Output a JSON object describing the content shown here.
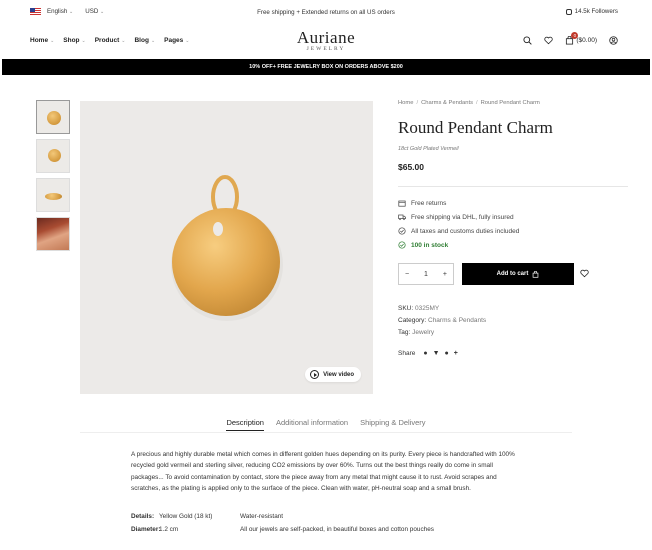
{
  "topbar": {
    "language": "English",
    "currency": "USD",
    "announcement": "Free shipping + Extended returns on all US orders",
    "followers": "14.5k Followers"
  },
  "nav": {
    "items": [
      "Home",
      "Shop",
      "Product",
      "Blog",
      "Pages"
    ]
  },
  "logo": {
    "name": "Auriane",
    "sub": "JEWELRY"
  },
  "cart": {
    "count": "0",
    "total": "($0.00)"
  },
  "promo": "10% OFF+ FREE JEWELRY BOX ON ORDERS ABOVE $200",
  "breadcrumb": [
    "Home",
    "Charms & Pendants",
    "Round Pendant Charm"
  ],
  "product": {
    "title": "Round Pendant Charm",
    "subtitle": "18ct Gold Plated Vermeil",
    "price": "$65.00",
    "features": [
      "Free returns",
      "Free shipping via DHL, fully insured",
      "All taxes and customs duties included",
      "100 in stock"
    ],
    "quantity": "1",
    "add_to_cart": "Add to cart",
    "view_video": "View video",
    "sku_label": "SKU:",
    "sku": "0325MY",
    "category_label": "Category:",
    "category": "Charms & Pendants",
    "tag_label": "Tag:",
    "tag": "Jewelry",
    "share_label": "Share"
  },
  "tabs": [
    "Description",
    "Additional information",
    "Shipping & Delivery"
  ],
  "description": "A precious and highly durable metal which comes in different golden hues depending on its purity. Every piece is handcrafted with 100% recycled gold vermeil and sterling silver, reducing CO2 emissions by over 60%. Turns out the best things really do come in small packages... To avoid contamination by contact, store the piece away from any metal that might cause it to rust. Avoid scrapes and scratches, as the plating is applied only to the surface of the piece. Clean with water, pH-neutral soap and a small brush.",
  "details": {
    "details_label": "Details:",
    "details_value": "Yellow Gold (18 kt)",
    "details_extra": "Water-resistant",
    "diameter_label": "Diameter:",
    "diameter_value": "1.2 cm",
    "diameter_extra": "All our jewels are self-packed, in beautiful boxes and cotton pouches"
  },
  "colors": {
    "promo_bg": "#000000",
    "stock": "#2e7d32",
    "badge": "#c0392b"
  }
}
